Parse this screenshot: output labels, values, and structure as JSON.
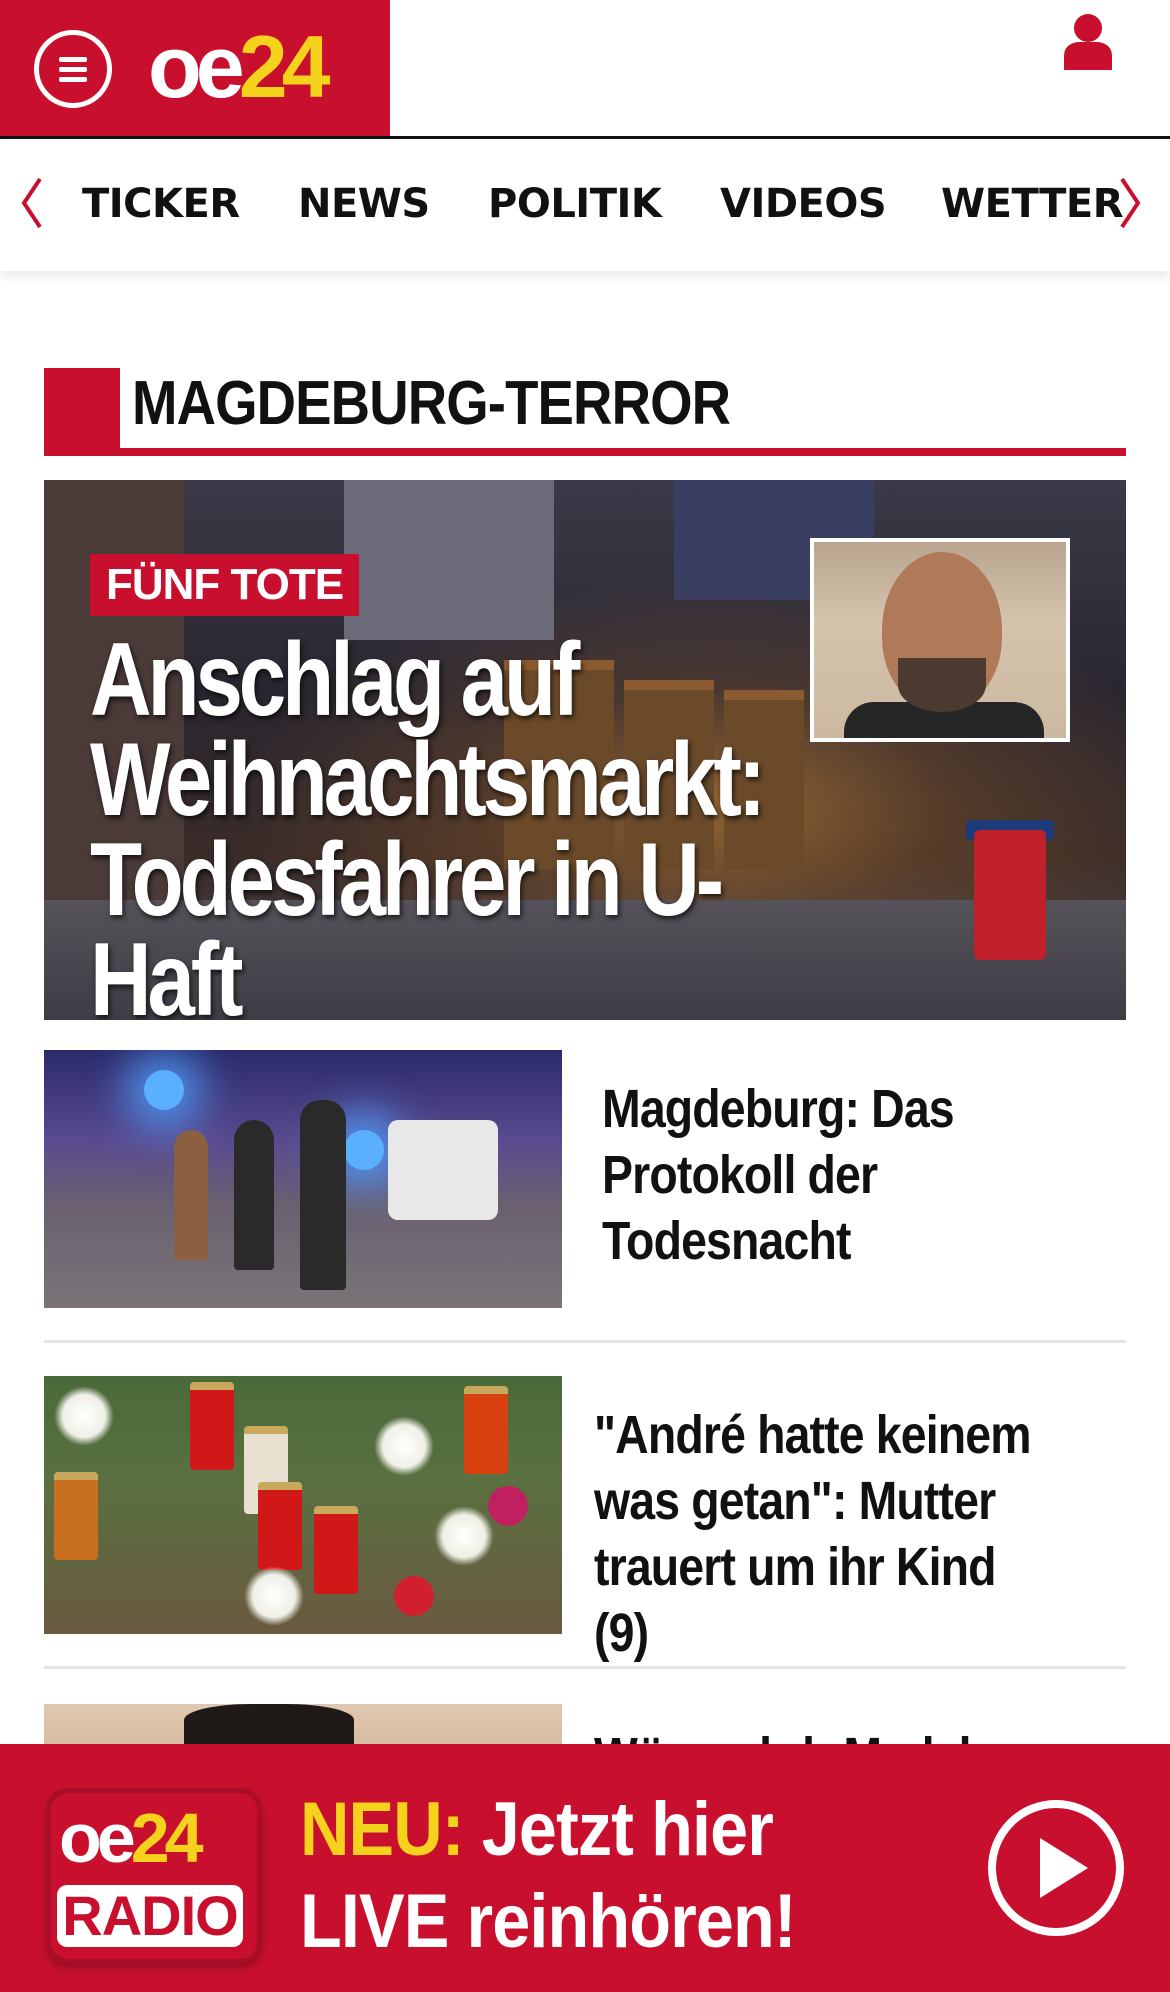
{
  "header": {
    "logo": {
      "oe": "oe",
      "num": "24"
    },
    "colors": {
      "brand": "#c8102e",
      "logo_accent": "#f5d21c"
    }
  },
  "nav": {
    "items": [
      "TICKER",
      "NEWS",
      "POLITIK",
      "VIDEOS",
      "WETTER"
    ]
  },
  "section": {
    "title": "MAGDEBURG-TERROR"
  },
  "hero": {
    "badge": "FÜNF TOTE",
    "title_lines": [
      "Anschlag auf",
      "Weihnachtsmarkt:",
      "Todesfahrer in U-Haft"
    ]
  },
  "articles": [
    {
      "title_lines": [
        "Magdeburg: Das",
        "Protokoll der",
        "Todesnacht"
      ]
    },
    {
      "title_lines": [
        "\"André hatte keinem",
        "was getan\": Mutter",
        "trauert um ihr Kind (9)"
      ]
    },
    {
      "title_lines": [
        "Würgeabdr Madel..."
      ]
    }
  ],
  "banner": {
    "logo_top": {
      "oe": "oe",
      "num": "24"
    },
    "logo_bottom": "RADIO",
    "neu": "NEU:",
    "line1_rest": " Jetzt hier",
    "line2": "LIVE reinhören!"
  },
  "icons": {
    "menu": "hamburger-menu-icon",
    "user": "user-icon",
    "nav_left": "chevron-left-icon",
    "nav_right": "chevron-right-icon",
    "play": "play-icon"
  }
}
